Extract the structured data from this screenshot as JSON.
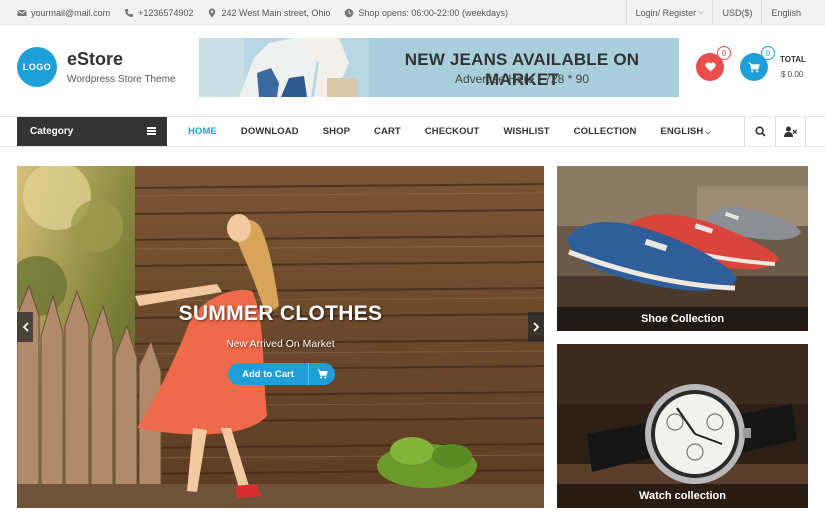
{
  "topbar": {
    "email": "yourmail@mail.com",
    "phone": "+1236574902",
    "address": "242 West Main street, Ohio",
    "hours": "Shop opens: 06:00-22:00 (weekdays)",
    "login": "Login/ Register",
    "currency": "USD($)",
    "language": "English"
  },
  "header": {
    "logo_text": "LOGO",
    "site_title": "eStore",
    "site_tagline": "Wordpress Store Theme",
    "banner_title": "NEW JEANS AVAILABLE ON MARKET",
    "banner_subtitle": "Advertise Here : 728 * 90",
    "wishlist_count": "0",
    "cart_count": "0",
    "total_label": "TOTAL",
    "total_value": "$ 0.00"
  },
  "nav": {
    "category_label": "Category",
    "items": [
      "HOME",
      "DOWNLOAD",
      "SHOP",
      "CART",
      "CHECKOUT",
      "WISHLIST",
      "COLLECTION",
      "ENGLISH"
    ]
  },
  "slider": {
    "title": "SUMMER CLOTHES",
    "subtitle": "New Arrived On Market",
    "button_label": "Add to Cart"
  },
  "cards": [
    {
      "caption": "Shoe Collection"
    },
    {
      "caption": "Watch collection"
    }
  ],
  "colors": {
    "accent": "#1e9fd8",
    "wishlist": "#e84c4c",
    "category_bg": "#333333"
  }
}
